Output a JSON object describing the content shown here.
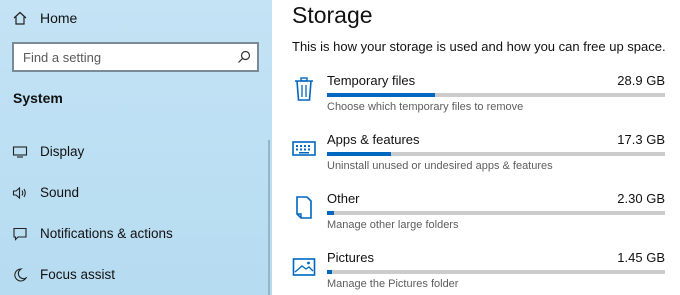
{
  "sidebar": {
    "home_label": "Home",
    "search_placeholder": "Find a setting",
    "section_title": "System",
    "items": [
      {
        "label": "Display",
        "icon": "monitor-icon"
      },
      {
        "label": "Sound",
        "icon": "speaker-icon"
      },
      {
        "label": "Notifications & actions",
        "icon": "notifications-icon"
      },
      {
        "label": "Focus assist",
        "icon": "moon-icon"
      }
    ]
  },
  "main": {
    "title": "Storage",
    "description": "This is how your storage is used and how you can free up space.",
    "categories": [
      {
        "name": "Temporary files",
        "size": "28.9 GB",
        "subtitle": "Choose which temporary files to remove",
        "usage_fraction": 0.32,
        "icon": "trash-icon"
      },
      {
        "name": "Apps & features",
        "size": "17.3 GB",
        "subtitle": "Uninstall unused or undesired apps & features",
        "usage_fraction": 0.19,
        "icon": "keyboard-icon"
      },
      {
        "name": "Other",
        "size": "2.30 GB",
        "subtitle": "Manage other large folders",
        "usage_fraction": 0.02,
        "icon": "document-icon"
      },
      {
        "name": "Pictures",
        "size": "1.45 GB",
        "subtitle": "Manage the Pictures folder",
        "usage_fraction": 0.015,
        "icon": "picture-icon"
      }
    ]
  },
  "colors": {
    "accent": "#0067c0",
    "track": "#cccccc",
    "sidebar": "#c0e1f4"
  }
}
